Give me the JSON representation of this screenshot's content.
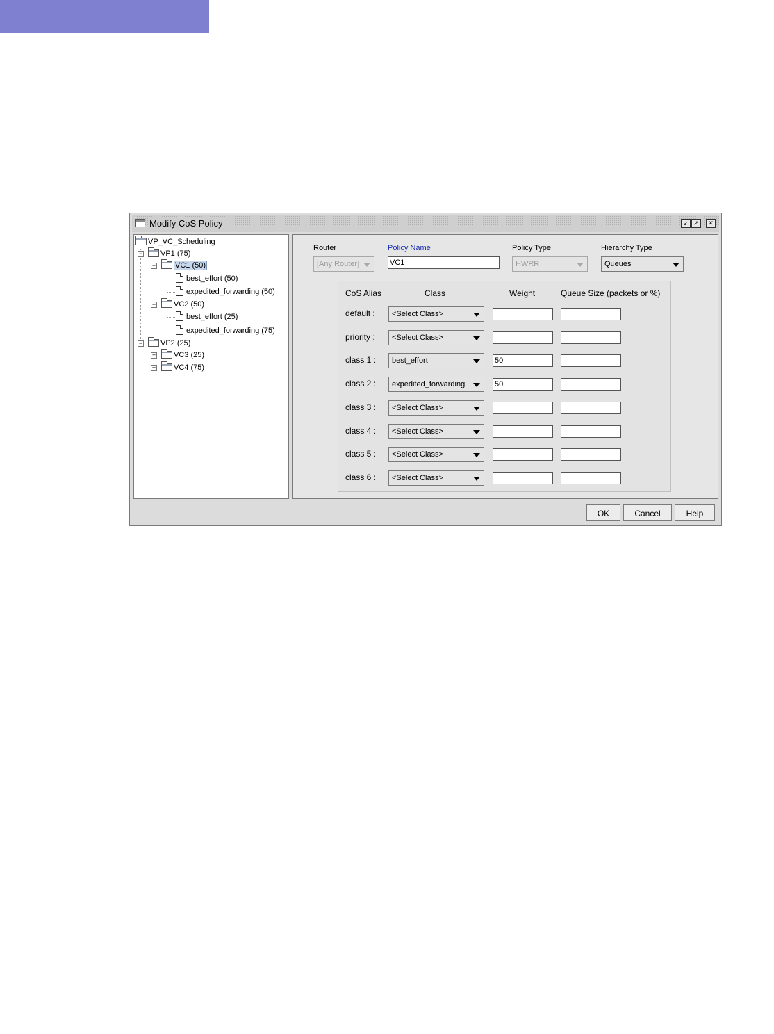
{
  "dialog": {
    "title": "Modify CoS Policy",
    "buttons": {
      "ok": "OK",
      "cancel": "Cancel",
      "help": "Help"
    }
  },
  "tree": {
    "root": "VP_VC_Scheduling",
    "vp1": "VP1 (75)",
    "vc1": "VC1 (50)",
    "vc1_best_effort": "best_effort (50)",
    "vc1_expedited": "expedited_forwarding (50)",
    "vc2": "VC2 (50)",
    "vc2_best_effort": "best_effort (25)",
    "vc2_expedited": "expedited_forwarding (75)",
    "vp2": "VP2 (25)",
    "vc3": "VC3 (25)",
    "vc4": "VC4 (75)"
  },
  "form": {
    "router_label": "Router",
    "router_value": "[Any Router]",
    "policy_name_label": "Policy Name",
    "policy_name_value": "VC1",
    "policy_type_label": "Policy Type",
    "policy_type_value": "HWRR",
    "hierarchy_type_label": "Hierarchy Type",
    "hierarchy_type_value": "Queues",
    "accent_color": "#1a2fb0"
  },
  "cos_table": {
    "headers": {
      "alias": "CoS Alias",
      "class": "Class",
      "weight": "Weight",
      "queue_size": "Queue Size (packets or %)"
    },
    "rows": [
      {
        "alias": "default :",
        "class": "<Select Class>",
        "weight": "",
        "queue": ""
      },
      {
        "alias": "priority :",
        "class": "<Select Class>",
        "weight": "",
        "queue": ""
      },
      {
        "alias": "class 1 :",
        "class": "best_effort",
        "weight": "50",
        "queue": ""
      },
      {
        "alias": "class 2 :",
        "class": "expedited_forwarding",
        "weight": "50",
        "queue": ""
      },
      {
        "alias": "class 3 :",
        "class": "<Select Class>",
        "weight": "",
        "queue": ""
      },
      {
        "alias": "class 4 :",
        "class": "<Select Class>",
        "weight": "",
        "queue": ""
      },
      {
        "alias": "class 5 :",
        "class": "<Select Class>",
        "weight": "",
        "queue": ""
      },
      {
        "alias": "class 6 :",
        "class": "<Select Class>",
        "weight": "",
        "queue": ""
      }
    ]
  }
}
